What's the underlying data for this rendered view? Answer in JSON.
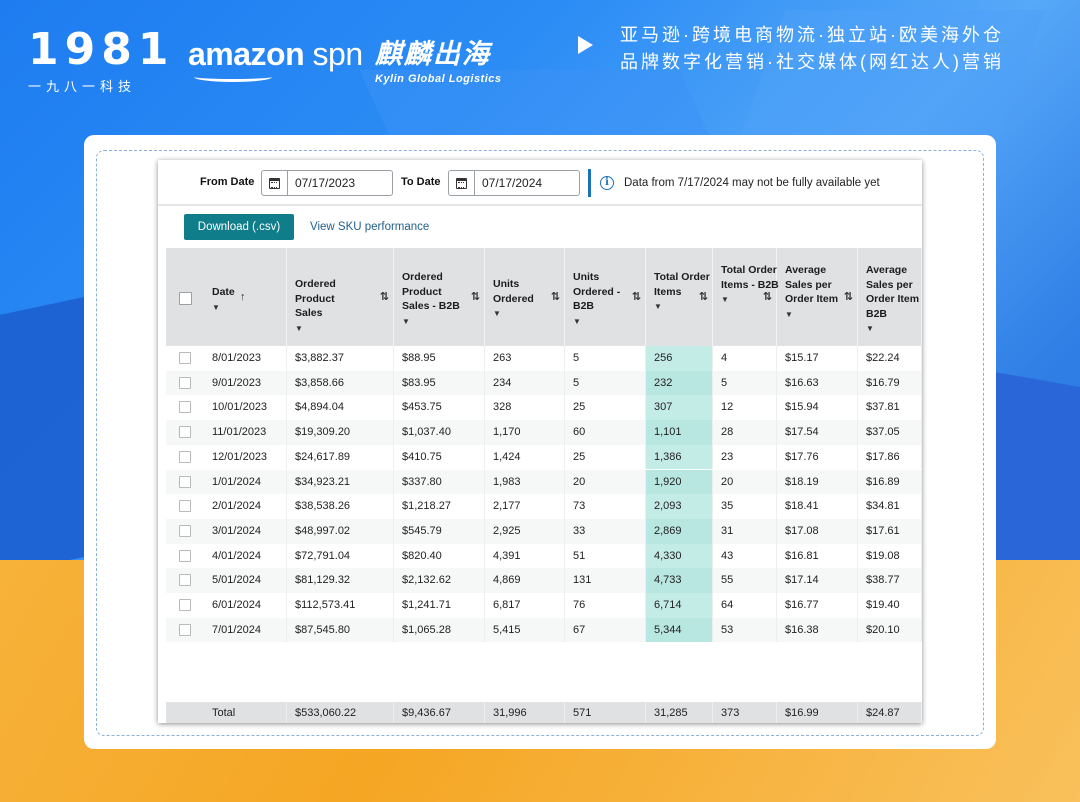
{
  "header": {
    "logo_digits": "1981",
    "logo_sub": "一九八一科技",
    "amazon_word": "amazon",
    "amazon_spn": " spn",
    "kylin_cn": "麒麟出海",
    "kylin_en": "Kylin Global Logistics",
    "tagline_line1": "亚马逊·跨境电商物流·独立站·欧美海外仓",
    "tagline_line2": "品牌数字化营销·社交媒体(网红达人)营销"
  },
  "filters": {
    "from_label": "From Date",
    "from_value": "07/17/2023",
    "to_label": "To Date",
    "to_value": "07/17/2024",
    "notice": "Data from 7/17/2024 may not be fully available yet"
  },
  "actions": {
    "download_label": "Download (.csv)",
    "sku_link": "View SKU performance"
  },
  "table": {
    "columns": [
      {
        "key": "date",
        "label": "Date",
        "sort": "↑"
      },
      {
        "key": "sales",
        "label": "Ordered Product Sales",
        "sort": "⇅"
      },
      {
        "key": "sales_b2b",
        "label": "Ordered Product Sales - B2B",
        "sort": "⇅"
      },
      {
        "key": "units",
        "label": "Units Ordered",
        "sort": "⇅"
      },
      {
        "key": "units_b2b",
        "label": "Units Ordered - B2B",
        "sort": "⇅"
      },
      {
        "key": "items",
        "label": "Total Order Items",
        "sort": "⇅"
      },
      {
        "key": "items_b2b",
        "label": "Total Order Items - B2B",
        "sort": "⇅"
      },
      {
        "key": "avg",
        "label": "Average Sales per Order Item",
        "sort": "⇅"
      },
      {
        "key": "avg_b2b",
        "label": "Average Sales per Order Item - B2B",
        "sort": ""
      }
    ],
    "rows": [
      [
        "8/01/2023",
        "$3,882.37",
        "$88.95",
        "263",
        "5",
        "256",
        "4",
        "$15.17",
        "$22.24"
      ],
      [
        "9/01/2023",
        "$3,858.66",
        "$83.95",
        "234",
        "5",
        "232",
        "5",
        "$16.63",
        "$16.79"
      ],
      [
        "10/01/2023",
        "$4,894.04",
        "$453.75",
        "328",
        "25",
        "307",
        "12",
        "$15.94",
        "$37.81"
      ],
      [
        "11/01/2023",
        "$19,309.20",
        "$1,037.40",
        "1,170",
        "60",
        "1,101",
        "28",
        "$17.54",
        "$37.05"
      ],
      [
        "12/01/2023",
        "$24,617.89",
        "$410.75",
        "1,424",
        "25",
        "1,386",
        "23",
        "$17.76",
        "$17.86"
      ],
      [
        "1/01/2024",
        "$34,923.21",
        "$337.80",
        "1,983",
        "20",
        "1,920",
        "20",
        "$18.19",
        "$16.89"
      ],
      [
        "2/01/2024",
        "$38,538.26",
        "$1,218.27",
        "2,177",
        "73",
        "2,093",
        "35",
        "$18.41",
        "$34.81"
      ],
      [
        "3/01/2024",
        "$48,997.02",
        "$545.79",
        "2,925",
        "33",
        "2,869",
        "31",
        "$17.08",
        "$17.61"
      ],
      [
        "4/01/2024",
        "$72,791.04",
        "$820.40",
        "4,391",
        "51",
        "4,330",
        "43",
        "$16.81",
        "$19.08"
      ],
      [
        "5/01/2024",
        "$81,129.32",
        "$2,132.62",
        "4,869",
        "131",
        "4,733",
        "55",
        "$17.14",
        "$38.77"
      ],
      [
        "6/01/2024",
        "$112,573.41",
        "$1,241.71",
        "6,817",
        "76",
        "6,714",
        "64",
        "$16.77",
        "$19.40"
      ],
      [
        "7/01/2024",
        "$87,545.80",
        "$1,065.28",
        "5,415",
        "67",
        "5,344",
        "53",
        "$16.38",
        "$20.10"
      ]
    ],
    "total": [
      "Total",
      "$533,060.22",
      "$9,436.67",
      "31,996",
      "571",
      "31,285",
      "373",
      "$16.99",
      "$24.87"
    ]
  },
  "colors": {
    "accent": "#0f7d8a",
    "highlight_column": "#c4ece7",
    "info_border": "#1a73b8"
  }
}
